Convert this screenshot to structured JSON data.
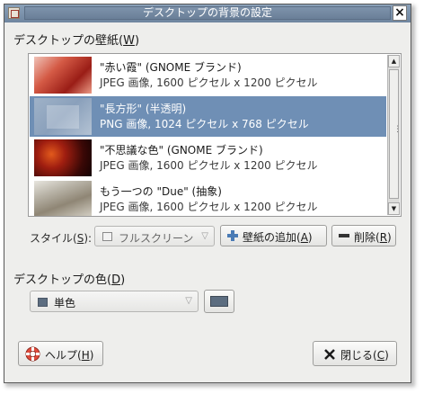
{
  "window": {
    "title": "デスクトップの背景の設定",
    "close_glyph": "×"
  },
  "wallpaper_section": {
    "label_prefix": "デスクトップの壁紙(",
    "label_key": "W",
    "label_suffix": ")"
  },
  "wallpapers": [
    {
      "name": "\"赤い霞\" (GNOME ブランド)",
      "description": "JPEG 画像, 1600 ピクセル x 1200 ピクセル"
    },
    {
      "name": "\"長方形\" (半透明)",
      "description": "PNG 画像, 1024 ピクセル x 768 ピクセル"
    },
    {
      "name": "\"不思議な色\" (GNOME ブランド)",
      "description": "JPEG 画像, 1600 ピクセル x 1200 ピクセル"
    },
    {
      "name": "もう一つの \"Due\" (抽象)",
      "description": "JPEG 画像, 1600 ピクセル x 1200 ピクセル"
    }
  ],
  "selected_wallpaper_index": 1,
  "scrollbar": {
    "up_glyph": "▲",
    "down_glyph": "▼",
    "grip": "⋮"
  },
  "style_row": {
    "label_prefix": "スタイル(",
    "label_key": "S",
    "label_suffix": "):",
    "style_value": "フルスクリーン",
    "add_prefix": "壁紙の追加(",
    "add_key": "A",
    "add_suffix": ")",
    "remove_prefix": "削除(",
    "remove_key": "R",
    "remove_suffix": ")"
  },
  "color_section": {
    "label_prefix": "デスクトップの色(",
    "label_key": "D",
    "label_suffix": ")",
    "color_mode": "単色",
    "color_swatch": "#5c6d80"
  },
  "footer": {
    "help_prefix": "ヘルプ(",
    "help_key": "H",
    "help_suffix": ")",
    "close_prefix": "閉じる(",
    "close_key": "C",
    "close_suffix": ")"
  },
  "colors": {
    "selection": "#6f8fb5",
    "titlebar": "#7e93ab"
  }
}
